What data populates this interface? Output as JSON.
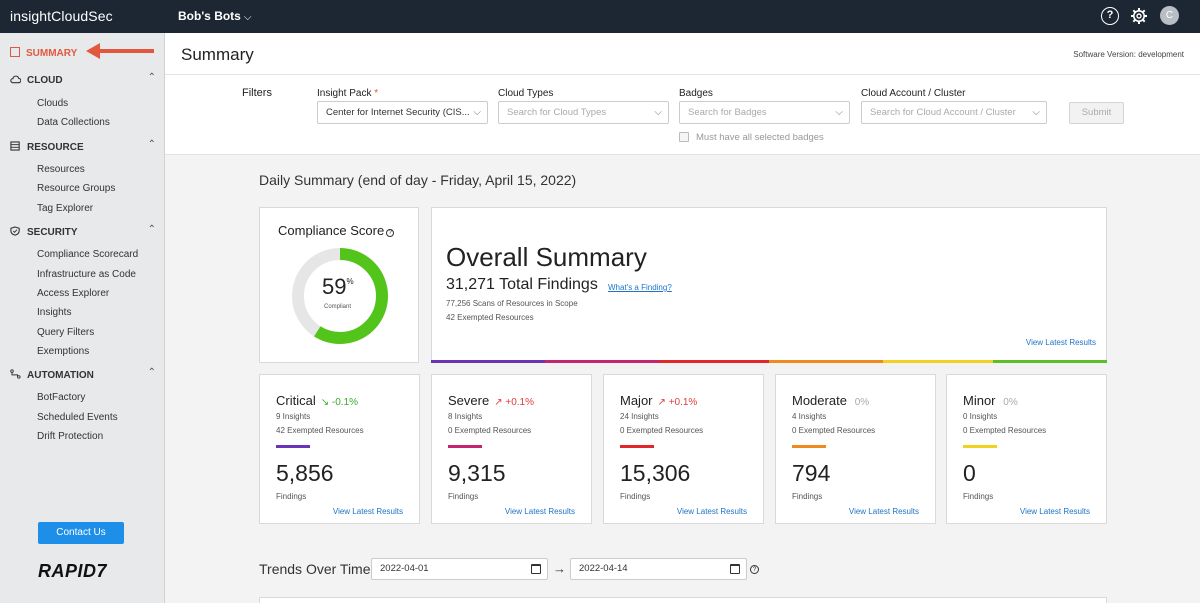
{
  "topbar": {
    "logo_prefix": "insight",
    "logo_suffix": "CloudSec",
    "org": "Bob's Bots",
    "org_caret": "⌵",
    "help": "?",
    "avatar": "C"
  },
  "sidebar": {
    "summary": "SUMMARY",
    "sections": [
      {
        "label": "CLOUD",
        "icon": "cloud-icon",
        "items": [
          "Clouds",
          "Data Collections"
        ]
      },
      {
        "label": "RESOURCE",
        "icon": "list-icon",
        "items": [
          "Resources",
          "Resource Groups",
          "Tag Explorer"
        ]
      },
      {
        "label": "SECURITY",
        "icon": "shield-icon",
        "items": [
          "Compliance Scorecard",
          "Infrastructure as Code",
          "Access Explorer",
          "Insights",
          "Query Filters",
          "Exemptions"
        ]
      },
      {
        "label": "AUTOMATION",
        "icon": "automation-icon",
        "items": [
          "BotFactory",
          "Scheduled Events",
          "Drift Protection"
        ]
      }
    ],
    "chevron": "⌃",
    "contact": "Contact Us",
    "brand": "RAPID7"
  },
  "header": {
    "title": "Summary",
    "version_label": "Software Version:",
    "version_value": "development"
  },
  "filters": {
    "label": "Filters",
    "insight_pack": {
      "label": "Insight Pack",
      "required": "*",
      "value": "Center for Internet Security (CIS..."
    },
    "cloud_types": {
      "label": "Cloud Types",
      "placeholder": "Search for Cloud Types"
    },
    "badges": {
      "label": "Badges",
      "placeholder": "Search for Badges"
    },
    "cloud_account": {
      "label": "Cloud Account / Cluster",
      "placeholder": "Search for Cloud Account / Cluster"
    },
    "must_have": "Must have all selected badges",
    "submit": "Submit",
    "dropdown_glyph": "⌵"
  },
  "daily": {
    "title": "Daily Summary (end of day - Friday, April 15, 2022)",
    "compliance": {
      "title": "Compliance Score",
      "help": "?",
      "value": "59",
      "unit": "%",
      "sub": "Compliant",
      "fraction": 0.59
    },
    "overall": {
      "title": "Overall Summary",
      "findings": "31,271 Total Findings",
      "link": "What's a Finding?",
      "scans": "77,256 Scans of Resources in Scope",
      "exempted": "42 Exempted Resources",
      "view": "View Latest Results"
    },
    "severities": [
      {
        "name": "Critical",
        "arrow": "↘",
        "delta": "-0.1%",
        "delta_color": "#3aa82e",
        "insights": "9 Insights",
        "exempted": "42 Exempted Resources",
        "color": "#6a35b5",
        "count": "5,856",
        "findings": "Findings",
        "view": "View Latest Results"
      },
      {
        "name": "Severe",
        "arrow": "↗",
        "delta": "+0.1%",
        "delta_color": "#e23b3b",
        "insights": "8 Insights",
        "exempted": "0 Exempted Resources",
        "color": "#c5246e",
        "count": "9,315",
        "findings": "Findings",
        "view": "View Latest Results"
      },
      {
        "name": "Major",
        "arrow": "↗",
        "delta": "+0.1%",
        "delta_color": "#e23b3b",
        "insights": "24 Insights",
        "exempted": "0 Exempted Resources",
        "color": "#e0272a",
        "count": "15,306",
        "findings": "Findings",
        "view": "View Latest Results"
      },
      {
        "name": "Moderate",
        "arrow": "",
        "delta": "0%",
        "delta_color": "#aaaaaa",
        "insights": "4 Insights",
        "exempted": "0 Exempted Resources",
        "color": "#ee8a1e",
        "count": "794",
        "findings": "Findings",
        "view": "View Latest Results"
      },
      {
        "name": "Minor",
        "arrow": "",
        "delta": "0%",
        "delta_color": "#aaaaaa",
        "insights": "0 Insights",
        "exempted": "0 Exempted Resources",
        "color": "#f1d21e",
        "count": "0",
        "findings": "Findings",
        "view": "View Latest Results"
      }
    ],
    "rainbow_colors": [
      "#6a35b5",
      "#c5246e",
      "#e0272a",
      "#ee8a1e",
      "#f1d21e",
      "#5bbf2a"
    ]
  },
  "trends": {
    "title": "Trends Over Time",
    "start": "2022-04-01",
    "end": "2022-04-14",
    "arrow": "→",
    "help": "?"
  },
  "colors": {
    "accent": "#e2583e",
    "link": "#1e73c8",
    "donut_fill": "#52c41a",
    "donut_track": "#e6e6e6"
  }
}
